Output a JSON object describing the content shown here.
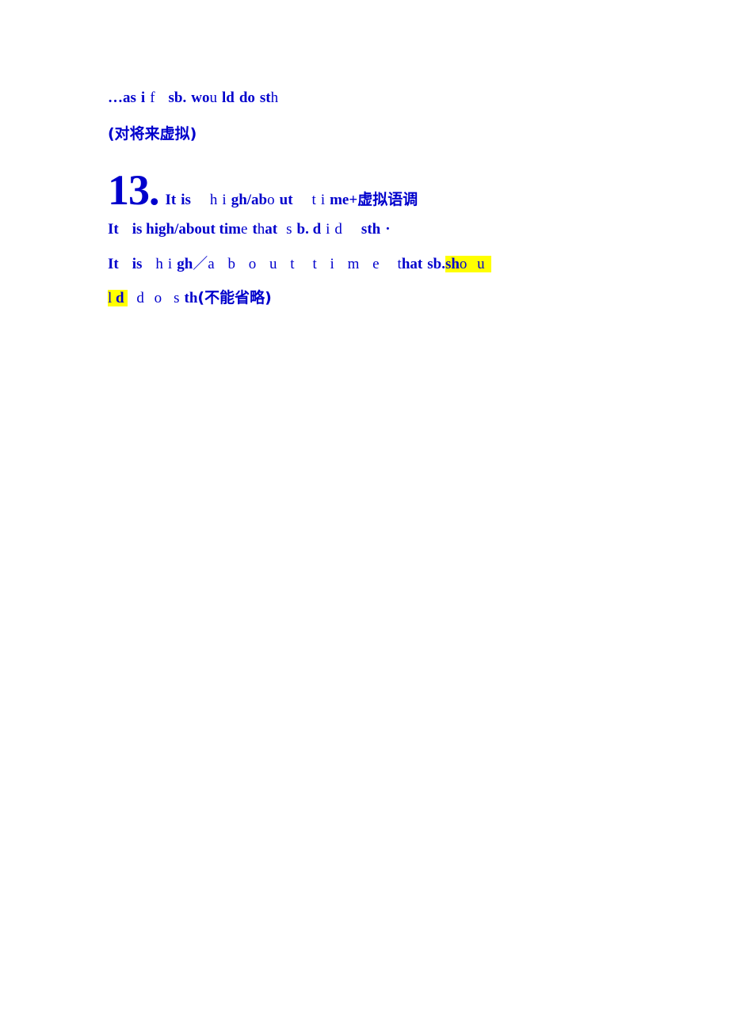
{
  "document": {
    "type": "grammar-study-note",
    "language": "zh-CN / en",
    "text_color": "#0000cc",
    "highlight_color": "#ffff00",
    "background": "#ffffff"
  },
  "lines": {
    "as_if": {
      "full": "…as i f  sb. wo u ld do st h",
      "seg_ellipsis": "…",
      "seg_as": "as",
      "seg_i": "i",
      "seg_f": "f",
      "seg_sb": "sb.",
      "seg_wo": "wo",
      "seg_u": "u",
      "seg_ld": "ld",
      "seg_do": "do",
      "seg_st": "st",
      "seg_h": "h"
    },
    "note_future": "(对将来虚拟)",
    "heading": {
      "number": "13.",
      "seg_It": "It",
      "seg_is": "is",
      "seg_h": "h",
      "seg_i": "i",
      "seg_gh_about": "gh/ab",
      "seg_o": "o",
      "seg_ut": "ut",
      "seg_t": "t",
      "seg_i2": "i",
      "seg_me": "me+",
      "seg_zh": "虚拟语调"
    },
    "pattern_past": {
      "seg_It": "It",
      "seg_is_high_about_time": "is high/about tim",
      "seg_e": "e",
      "seg_t": "t",
      "seg_h": "h",
      "seg_at": "at",
      "seg_s": "s",
      "seg_b_d": "b. d",
      "seg_i": "i",
      "seg_d": "d",
      "seg_sth": "sth",
      "seg_dot": "·"
    },
    "pattern_should_a": {
      "seg_It": "It",
      "seg_is": "is",
      "seg_h": "h",
      "seg_i": "i",
      "seg_gh": "gh",
      "seg_slash": "／",
      "seg_about": "a b o u t",
      "seg_time": "t i m e",
      "seg_t": "t",
      "seg_hat": "hat",
      "seg_sb": "sb.",
      "seg_sh_hl": "sh",
      "seg_ou_hl": "o u"
    },
    "pattern_should_b": {
      "seg_l_hl": "l",
      "seg_d_hl": "d",
      "seg_do": "d o",
      "seg_s": "s",
      "seg_th": "th",
      "seg_note": "(不能省略)"
    }
  }
}
